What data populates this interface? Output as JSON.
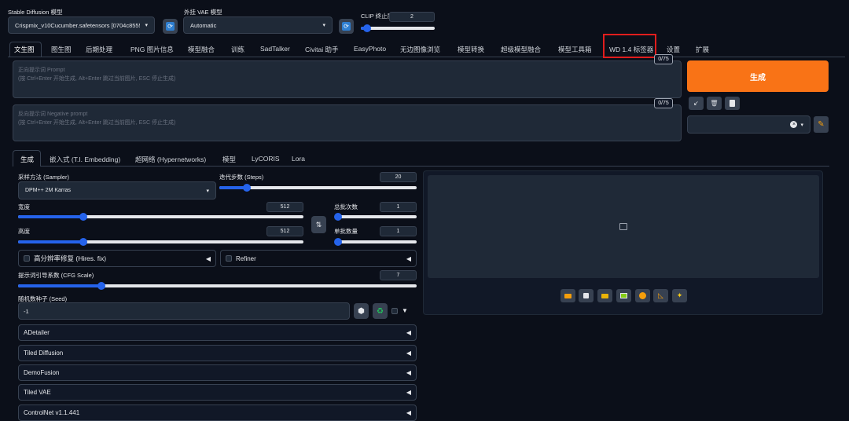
{
  "top": {
    "model_label": "Stable Diffusion 模型",
    "model_value": "Crispmix_v10Cucumber.safetensors [0704c8555",
    "vae_label": "外挂 VAE 模型",
    "vae_value": "Automatic",
    "clip_label": "CLIP 终止层数",
    "clip_value": "2",
    "clip_fraction": 0.08
  },
  "tabs": [
    "文生图",
    "图生图",
    "后期处理",
    "PNG 图片信息",
    "模型融合",
    "训练",
    "SadTalker",
    "Civitai 助手",
    "EasyPhoto",
    "无边图像浏览",
    "模型转换",
    "超级模型融合",
    "模型工具箱",
    "WD 1.4 标签器",
    "设置",
    "扩展"
  ],
  "prompt": {
    "placeholder_line1": "正向提示词 Prompt",
    "placeholder_line2": "(按 Ctrl+Enter 开始生成, Alt+Enter 跳过当前图片, ESC 停止生成)",
    "counter": "0/75"
  },
  "negative": {
    "placeholder_line1": "反向提示词 Negative prompt",
    "placeholder_line2": "(按 Ctrl+Enter 开始生成, Alt+Enter 跳过当前图片, ESC 停止生成)",
    "counter": "0/75"
  },
  "generate_label": "生成",
  "subtabs": [
    "生成",
    "嵌入式 (T.I. Embedding)",
    "超网络 (Hypernetworks)",
    "模型",
    "LyCORIS",
    "Lora"
  ],
  "params": {
    "sampler_label": "采样方法 (Sampler)",
    "sampler_value": "DPM++ 2M Karras",
    "steps_label": "迭代步数 (Steps)",
    "steps_value": "20",
    "steps_fraction": 0.14,
    "width_label": "宽度",
    "width_value": "512",
    "width_fraction": 0.23,
    "height_label": "高度",
    "height_value": "512",
    "height_fraction": 0.23,
    "batch_count_label": "总批次数",
    "batch_count_value": "1",
    "batch_count_fraction": 0.0,
    "batch_size_label": "单批数量",
    "batch_size_value": "1",
    "batch_size_fraction": 0.0,
    "hires_label": "高分辨率修复 (Hires. fix)",
    "refiner_label": "Refiner",
    "cfg_label": "提示词引导系数 (CFG Scale)",
    "cfg_value": "7",
    "cfg_fraction": 0.21,
    "seed_label": "随机数种子 (Seed)",
    "seed_value": "-1"
  },
  "accordions": [
    "ADetailer",
    "Tiled Diffusion",
    "DemoFusion",
    "Tiled VAE",
    "ControlNet v1.1.441"
  ],
  "colors": {
    "accent": "#f97316",
    "highlight_box": "#e11d1d",
    "slider": "#2563eb"
  }
}
